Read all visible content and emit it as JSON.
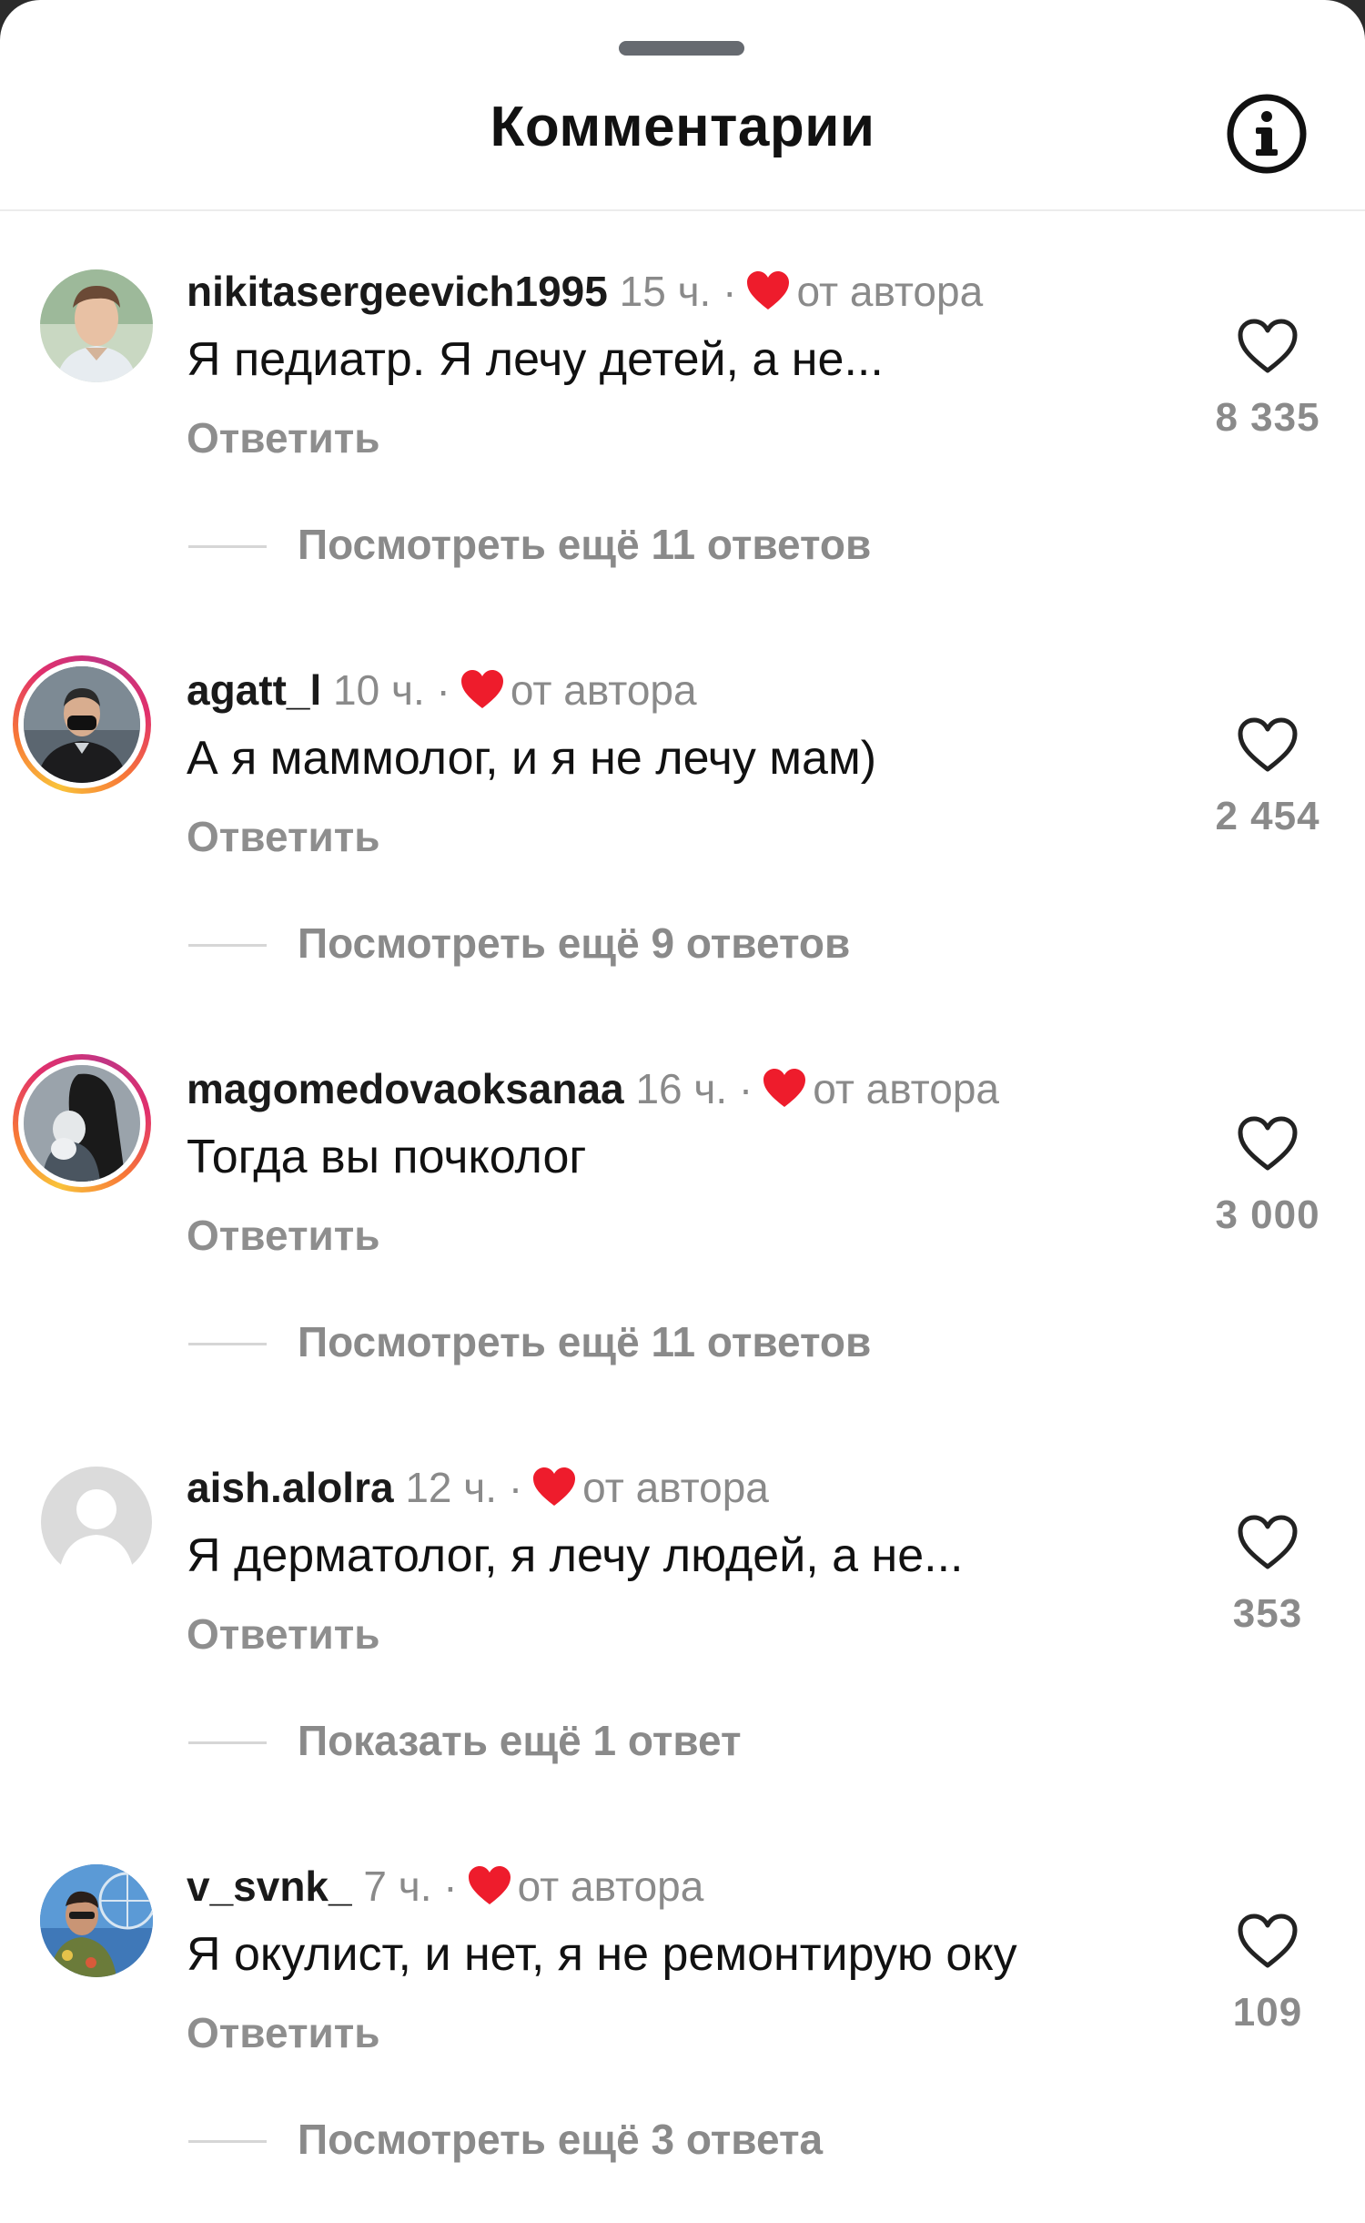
{
  "header": {
    "title": "Комментарии",
    "info_icon": "info-circle-icon"
  },
  "colors": {
    "heart_red": "#ee1c2c",
    "muted_text": "#8a8a8a",
    "ring_gradient": [
      "#f9c33a",
      "#f77737",
      "#e1306c",
      "#c13584"
    ]
  },
  "comments": [
    {
      "username": "nikitasergeevich1995",
      "time": "15 ч.",
      "separator": "·",
      "author_label": "от автора",
      "text": "Я педиатр. Я лечу детей, а не...",
      "reply_label": "Ответить",
      "likes": "8 335",
      "more_replies": "Посмотреть ещё 11 ответов",
      "avatar_ring": false
    },
    {
      "username": "agatt_l",
      "time": "10 ч.",
      "separator": "·",
      "author_label": "от автора",
      "text": "А я маммолог, и я не лечу мам)",
      "reply_label": "Ответить",
      "likes": "2 454",
      "more_replies": "Посмотреть ещё 9 ответов",
      "avatar_ring": true
    },
    {
      "username": "magomedovaoksanaa",
      "time": "16 ч.",
      "separator": "·",
      "author_label": "от автора",
      "text": "Тогда вы почколог",
      "reply_label": "Ответить",
      "likes": "3 000",
      "more_replies": "Посмотреть ещё 11 ответов",
      "avatar_ring": true
    },
    {
      "username": "aish.alolra",
      "time": "12 ч.",
      "separator": "·",
      "author_label": "от автора",
      "text": "Я дерматолог, я лечу людей, а не...",
      "reply_label": "Ответить",
      "likes": "353",
      "more_replies": "Показать ещё 1 ответ",
      "avatar_ring": false
    },
    {
      "username": "v_svnk_",
      "time": "7 ч.",
      "separator": "·",
      "author_label": "от автора",
      "text": "Я окулист, и нет, я не ремонтирую оку",
      "reply_label": "Ответить",
      "likes": "109",
      "more_replies": "Посмотреть ещё 3 ответа",
      "avatar_ring": false
    }
  ]
}
